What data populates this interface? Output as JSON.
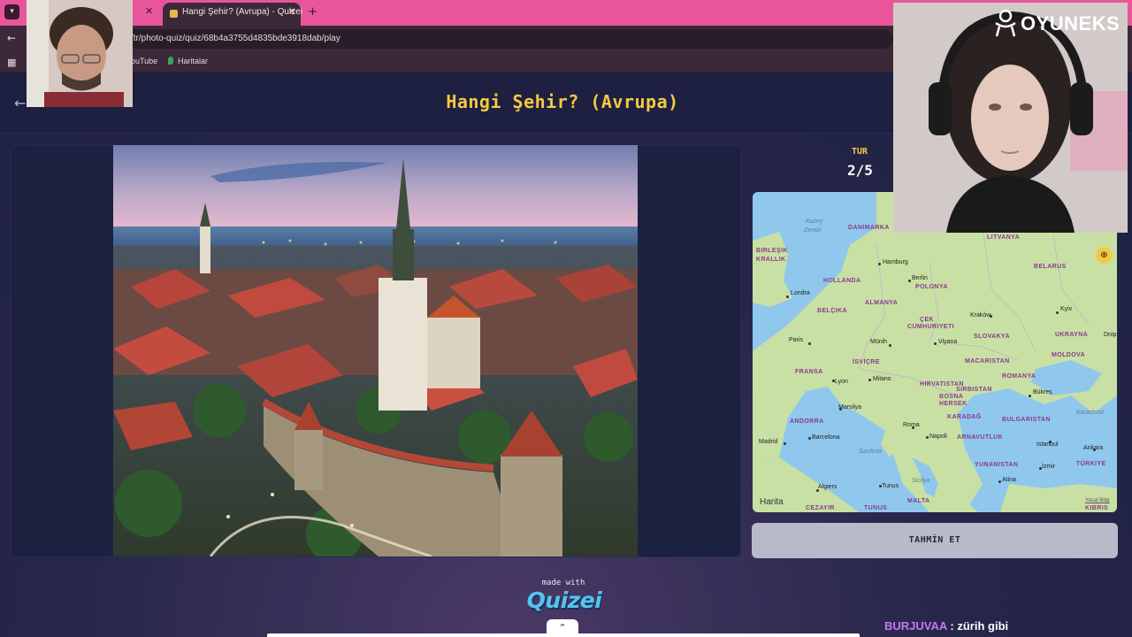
{
  "browser": {
    "tab_title": "Hangi Şehir? (Avrupa) - Quizei",
    "url": "/tr/photo-quiz/quiz/68b4a3755d4835bde3918dab/play",
    "bookmarks": [
      {
        "label": "ouTube"
      },
      {
        "label": "Haritalar"
      }
    ],
    "icons": {
      "menu": "chevron-down-icon",
      "back": "arrow-left-icon",
      "apps": "apps-grid-icon",
      "new_tab": "plus-icon",
      "close": "close-icon"
    }
  },
  "quiz": {
    "title": "Hangi Şehir? (Avrupa)",
    "round_label": "TUR",
    "round_value": "2/5",
    "guess_button": "TAHMİN ET",
    "made_with": "made with",
    "brand": "Quizei"
  },
  "map": {
    "brand": "Harita",
    "legal": "Yasal Bilgi",
    "countries": [
      "DANIMARKA",
      "LITVANYA",
      "BIRLEŞIK",
      "KRALLIK",
      "BELARUS",
      "HOLLANDA",
      "POLONYA",
      "ALMANYA",
      "BELÇIKA",
      "ÇEK",
      "CUMHURIYETI",
      "UKRAYNA",
      "SLOVAKYA",
      "MOLDOVA",
      "MACARISTAN",
      "FRANSA",
      "İSVİÇRE",
      "HIRVATISTAN",
      "ROMANYA",
      "BOSNA",
      "HERSEK",
      "SIRBISTAN",
      "ANDORRA",
      "KARADAĞ",
      "BULGARISTAN",
      "ARNAVUTLUK",
      "YUNANISTAN",
      "TÜRKIYE",
      "KIBRIS",
      "CEZAYIR",
      "TUNUS",
      "MALTA"
    ],
    "cities": [
      "Hamburg",
      "Berlin",
      "Londra",
      "Kraków",
      "Kyiv",
      "Paris",
      "Münih",
      "Viyana",
      "Lyon",
      "Milano",
      "Bükreş",
      "Marsilya",
      "Roma",
      "Napoli",
      "Madrid",
      "Barcelona",
      "Istanbul",
      "Ankara",
      "İzmir",
      "Atina",
      "Algiers",
      "Tunus",
      "Dnip"
    ],
    "seas": [
      "Kuzey",
      "Denizi",
      "Karadeniz",
      "Sardinia",
      "Sicilya"
    ],
    "icons": {
      "zoom": "zoom-in-icon"
    }
  },
  "chat": {
    "user": "BURJUVAA",
    "message": " : zürih gibi"
  },
  "overlay": {
    "streamer_brand": "OYUNEKS"
  },
  "colors": {
    "accent_yellow": "#f6c842",
    "tab_bar_pink": "#e9559a",
    "page_bg": "#1e2140",
    "chat_user": "#c07bf0",
    "quizei_blue": "#53c5ea"
  }
}
